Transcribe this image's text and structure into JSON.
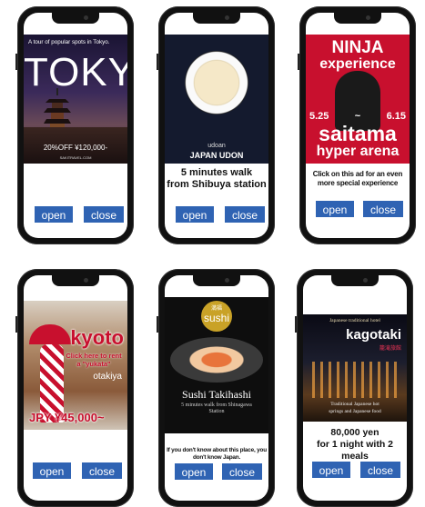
{
  "buttons": {
    "open": "open",
    "close": "close"
  },
  "ads": [
    {
      "tagline": "A tour of popular spots in Tokyo.",
      "headline": "TOKYO",
      "price": "20%OFF ¥120,000-",
      "site": "SAKITRAVEL.COM"
    },
    {
      "brand": "udoan",
      "headline": "JAPAN UDON",
      "caption_line1": "5 minutes walk",
      "caption_line2": "from Shibuya station"
    },
    {
      "headline_1": "NINJA",
      "headline_2": "experience",
      "date_start": "5.25",
      "date_sep": "~",
      "date_end": "6.15",
      "venue_1": "saitama",
      "venue_2": "hyper arena",
      "caption": "Click on this ad for an even more special experience"
    },
    {
      "headline": "kyoto",
      "sub_1": "Click here to rent a \"yukata\"",
      "sub_2": "otakiya",
      "price": "JPY ¥45,000~"
    },
    {
      "badge_top": "満福",
      "badge_main": "sushi",
      "name": "Sushi Takihashi",
      "walk": "5 minutes walk from Shinagawa Station",
      "caption": "If you don't know about this place, you don't know Japan."
    },
    {
      "top": "Japanese traditional hotel",
      "name": "kagotaki",
      "name_jp": "籠滝旅館",
      "foot_1": "Traditional Japanese hot",
      "foot_2": "springs and Japanese food",
      "caption_line1": "80,000 yen",
      "caption_line2": "for 1 night with 2 meals"
    }
  ]
}
